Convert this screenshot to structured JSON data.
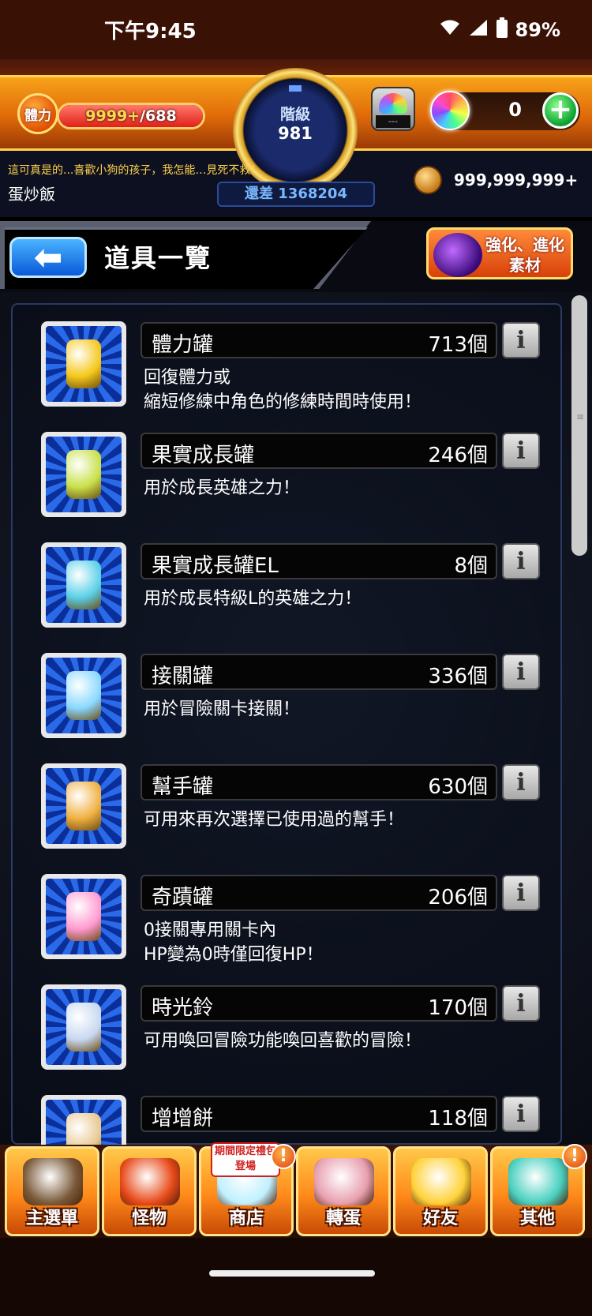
{
  "status_bar": {
    "time": "下午9:45",
    "battery": "89%"
  },
  "hud": {
    "stamina_icon_label": "體力",
    "stamina_current": "9999+",
    "stamina_max": "/688",
    "stamina_fill": 1.0,
    "rank_label": "階級",
    "rank_value": "981",
    "gacha_screen": "---",
    "orb_count": "0",
    "plus_label": "+",
    "player_message": "這可真是的...喜歡小狗的孩子，我怎能…見死不救！",
    "player_name": "蛋炒飯",
    "exp_remaining": "還差 1368204",
    "coins": "999,999,999+"
  },
  "title_bar": {
    "back_glyph": "⬅",
    "title": "道具一覽",
    "material_button": "強化、進化素材"
  },
  "items": [
    {
      "name": "體力罐",
      "count": "713個",
      "desc": "回復體力或\n縮短修練中角色的修練時間時使用！",
      "icon": "stamina-can-icon",
      "color": "#f5c81a"
    },
    {
      "name": "果實成長罐",
      "count": "246個",
      "desc": "用於成長英雄之力！",
      "icon": "fruit-growth-bottle-icon",
      "color": "#c8e04a"
    },
    {
      "name": "果實成長罐EL",
      "count": "8個",
      "desc": "用於成長特級L的英雄之力！",
      "icon": "fruit-growth-el-bottle-icon",
      "color": "#5ad0e8"
    },
    {
      "name": "接關罐",
      "count": "336個",
      "desc": "用於冒險關卡接關！",
      "icon": "continue-jar-icon",
      "color": "#8ad8ff"
    },
    {
      "name": "幫手罐",
      "count": "630個",
      "desc": "可用來再次選擇已使用過的幫手！",
      "icon": "helper-jar-icon",
      "color": "#f0b040"
    },
    {
      "name": "奇蹟罐",
      "count": "206個",
      "desc": "0接關專用關卡內\nHP變為0時僅回復HP！",
      "icon": "miracle-heart-jar-icon",
      "color": "#ff9ad0"
    },
    {
      "name": "時光鈴",
      "count": "170個",
      "desc": "可用喚回冒險功能喚回喜歡的冒險！",
      "icon": "time-bell-icon",
      "color": "#c8d8f0"
    },
    {
      "name": "增增餅",
      "count": "118個",
      "desc": "",
      "icon": "boost-cookie-icon",
      "color": "#e8c890"
    }
  ],
  "info_glyph": "i",
  "bottom_nav": [
    {
      "label": "主選單",
      "icon": "main-menu-castle-icon",
      "color": "#7a5a3a"
    },
    {
      "label": "怪物",
      "icon": "monster-icon",
      "color": "#e84a1a"
    },
    {
      "label": "商店",
      "icon": "shop-orb-icon",
      "color": "#c0f0ff",
      "badge": "期間限定禮包登場",
      "alert": "!"
    },
    {
      "label": "轉蛋",
      "icon": "gacha-characters-icon",
      "color": "#e8a0b0"
    },
    {
      "label": "好友",
      "icon": "friends-balloon-icon",
      "color": "#ffd23a"
    },
    {
      "label": "其他",
      "icon": "other-question-icon",
      "color": "#4ad0c0",
      "alert": "!"
    }
  ]
}
